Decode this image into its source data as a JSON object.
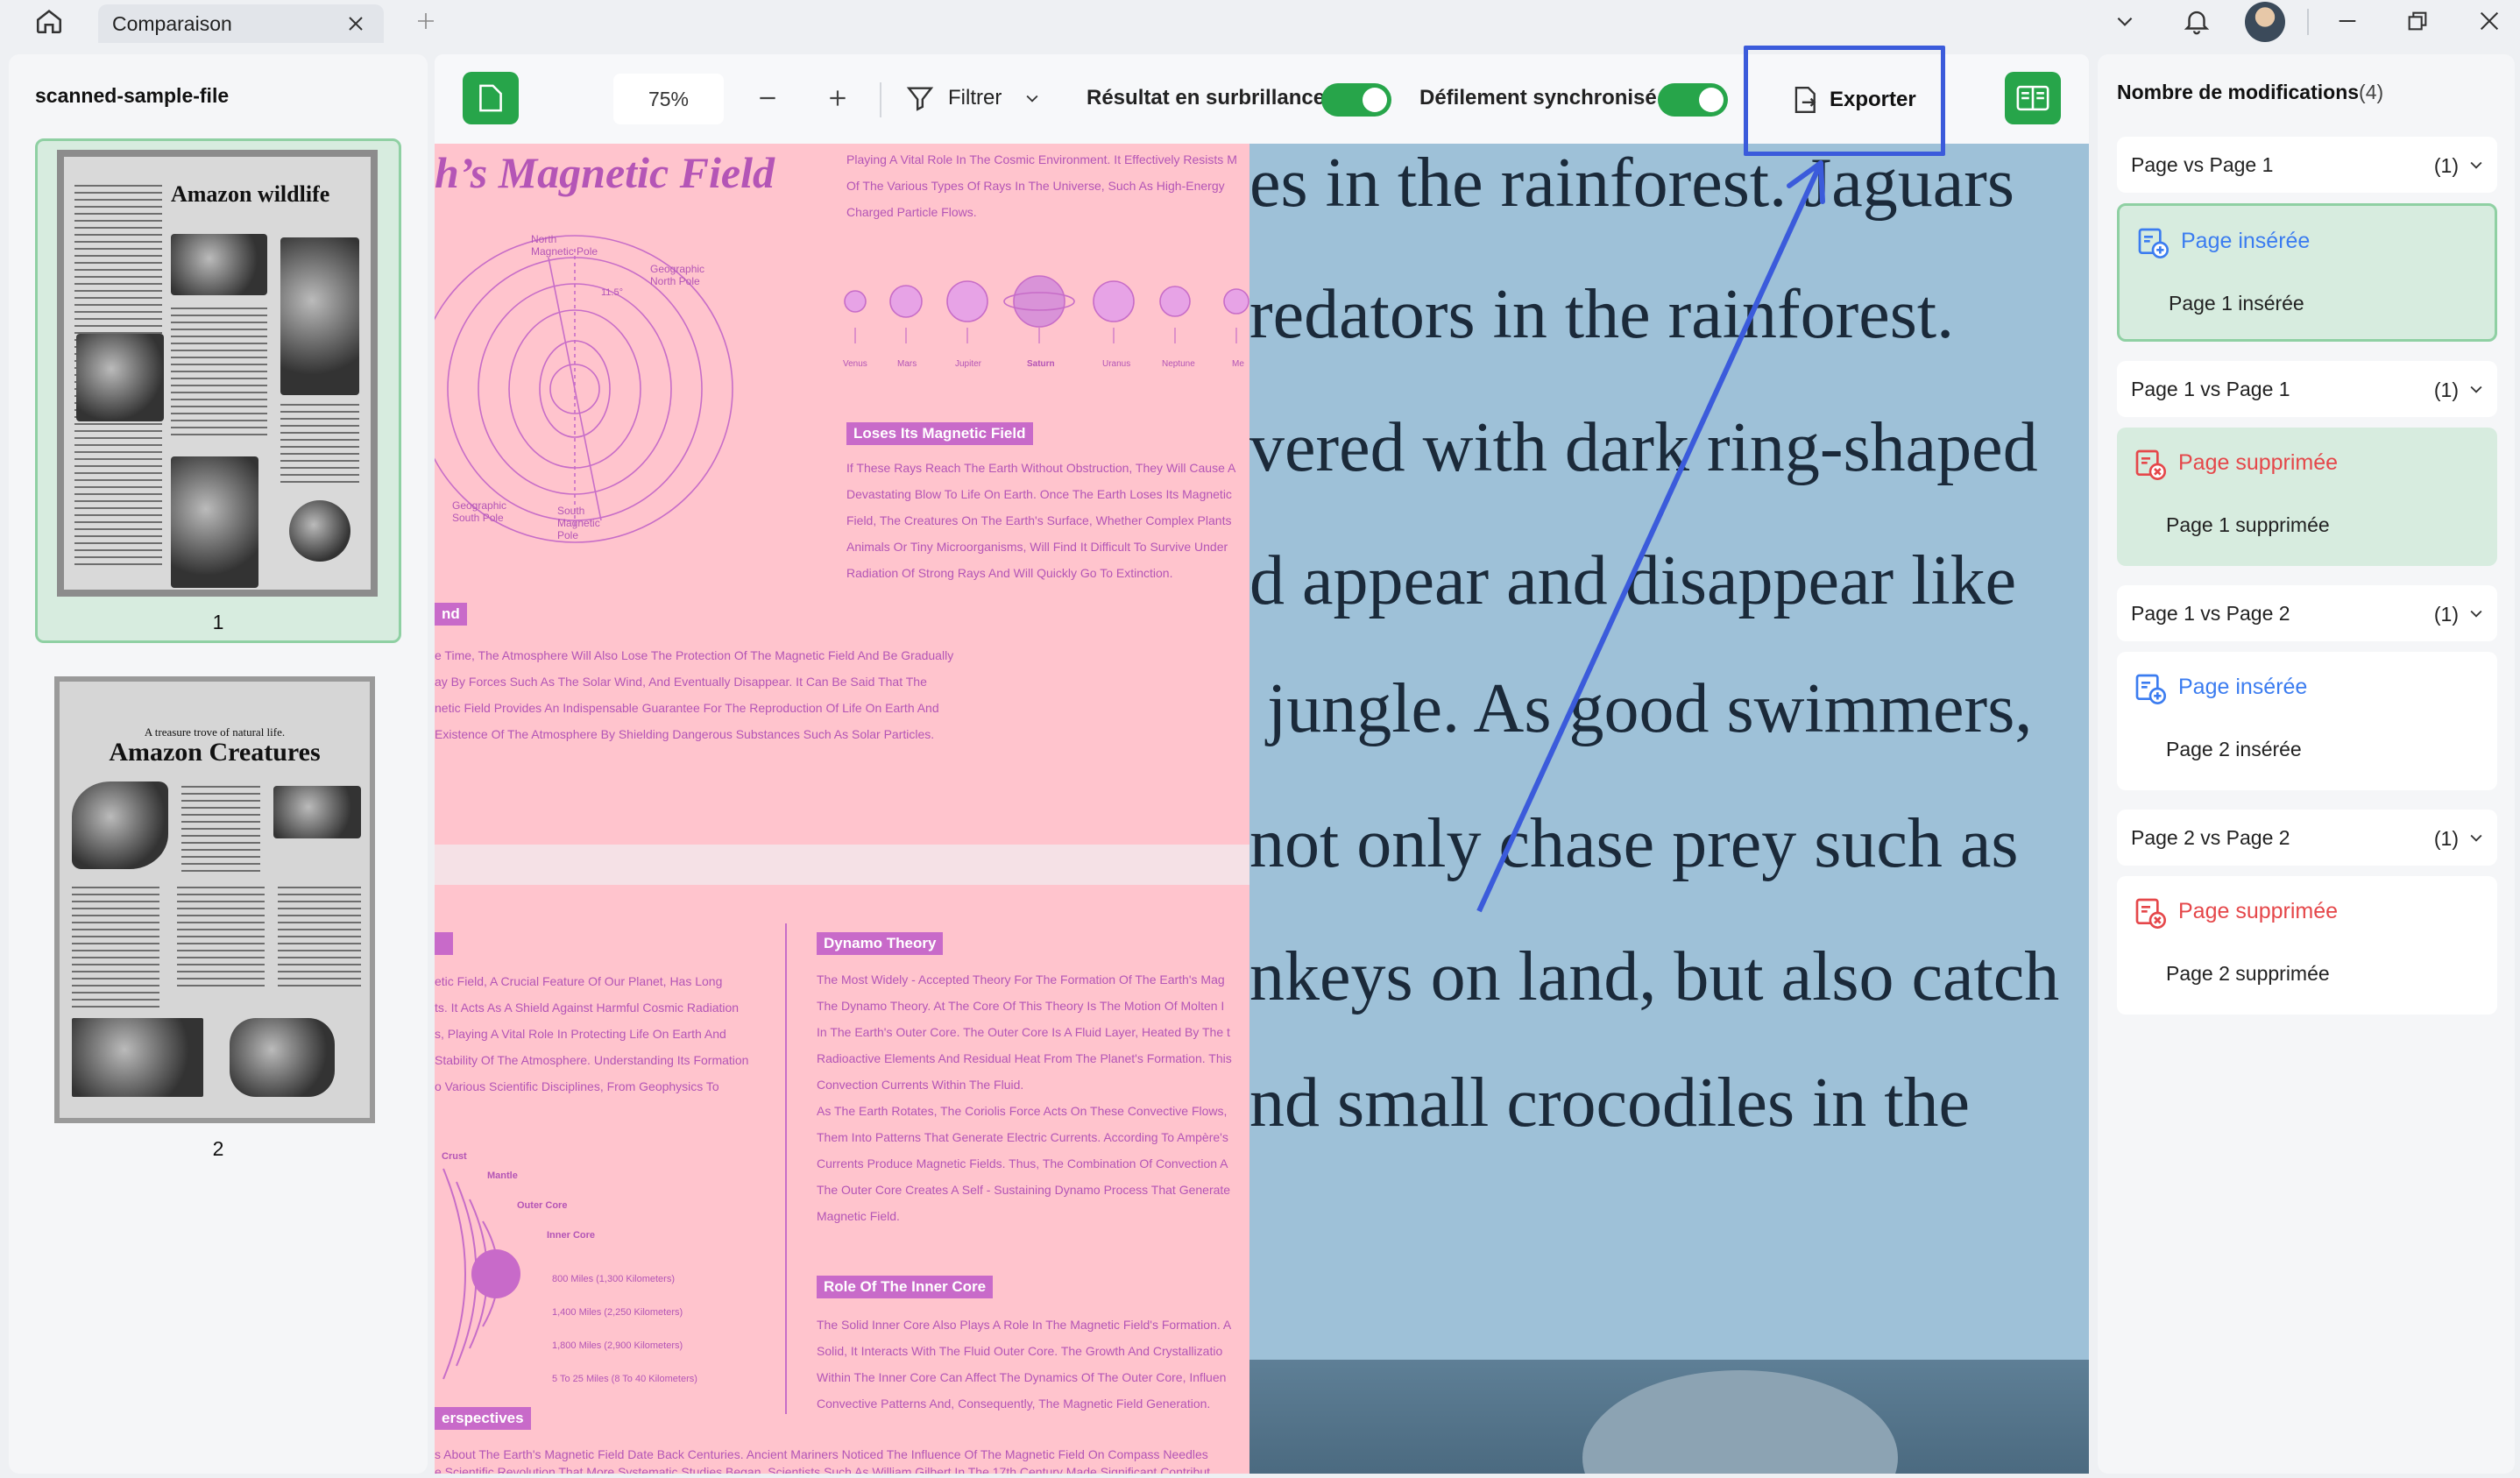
{
  "titlebar": {
    "tab_label": "Comparaison"
  },
  "left_panel": {
    "file_name": "scanned-sample-file",
    "thumbnails": [
      {
        "number": "1",
        "heading": "Amazon wildlife"
      },
      {
        "number": "2",
        "kicker": "A treasure trove of natural life.",
        "heading": "Amazon Creatures"
      }
    ]
  },
  "toolbar": {
    "zoom": "75%",
    "filter_label": "Filtrer",
    "highlight_label": "Résultat en surbrillance",
    "highlight_on": true,
    "sync_scroll_label": "Défilement synchronisé",
    "sync_scroll_on": true,
    "export_label": "Exporter"
  },
  "doc_left": {
    "title": "h’s Magnetic Field",
    "intro_lines": [
      "Playing A Vital Role In The Cosmic Environment. It Effectively Resists M",
      "Of The Various Types Of Rays In The Universe, Such As High-Energy",
      "Charged Particle Flows."
    ],
    "diagram_labels": {
      "north_pole": "North\nMagnetic Pole",
      "geo_north": "Geographic\nNorth Pole",
      "geo_south": "Geographic\nSouth Pole",
      "south_pole": "South\nMagnetic\nPole",
      "angle": "11.5°"
    },
    "planets": [
      "Venus",
      "Mars",
      "Jupiter",
      "Saturn",
      "Uranus",
      "Neptune",
      "Me"
    ],
    "loses_tag": "Loses Its Magnetic Field",
    "loses_lines": [
      "If These Rays Reach The Earth Without Obstruction, They Will Cause A",
      "Devastating Blow To Life On Earth. Once The Earth Loses Its Magnetic",
      "Field, The Creatures On The Earth's Surface, Whether Complex Plants",
      "Animals Or Tiny Microorganisms, Will Find It Difficult To Survive Under",
      "Radiation Of Strong Rays And Will Quickly Go To Extinction."
    ],
    "nd_tag": "nd",
    "lower_lines": [
      "e Time, The Atmosphere Will Also Lose The Protection Of The Magnetic Field And Be Gradually",
      "ay By Forces Such As The Solar Wind, And Eventually Disappear. It Can Be Said That The",
      "netic Field Provides An Indispensable Guarantee For The Reproduction Of Life On Earth And",
      "Existence Of The Atmosphere By Shielding Dangerous Substances Such As Solar Particles."
    ],
    "p2_left_lines": [
      "etic Field, A Crucial Feature Of Our Planet, Has Long",
      "ts. It Acts As A Shield Against Harmful Cosmic Radiation",
      "s, Playing A Vital Role In Protecting Life On Earth And",
      "Stability Of The Atmosphere. Understanding Its Formation",
      "o Various Scientific Disciplines, From Geophysics To"
    ],
    "dynamo_tag": "Dynamo Theory",
    "dynamo_lines": [
      "The Most Widely - Accepted Theory For The Formation Of The Earth's Mag",
      "The Dynamo Theory. At The Core Of This Theory Is The Motion Of Molten I",
      "In The Earth's Outer Core. The Outer Core Is A Fluid Layer, Heated By The t",
      "Radioactive Elements And Residual Heat From The Planet's Formation. This",
      "Convection Currents Within The Fluid.",
      "As The Earth Rotates, The Coriolis Force Acts On These Convective Flows,",
      "Them Into Patterns That Generate Electric Currents. According To Ampère's",
      "Currents Produce Magnetic Fields. Thus, The Combination Of Convection A",
      "The Outer Core Creates A Self - Sustaining Dynamo Process That Generate",
      "Magnetic Field."
    ],
    "core_labels": [
      "Crust",
      "Mantle",
      "Outer Core",
      "Inner Core"
    ],
    "core_distances": [
      "800 Miles (1,300 Kilometers)",
      "1,400 Miles (2,250 Kilometers)",
      "1,800 Miles (2,900 Kilometers)",
      "5 To 25 Miles (8 To 40 Kilometers)"
    ],
    "inner_tag": "Role Of The Inner Core",
    "inner_lines": [
      "The Solid Inner Core Also Plays A Role In The Magnetic Field's Formation. A",
      "Solid, It Interacts With The Fluid Outer Core. The Growth And Crystallizatio",
      "Within The Inner Core Can Affect The Dynamics Of The Outer Core, Influen",
      "Convective Patterns And, Consequently, The Magnetic Field Generation."
    ],
    "persp_tag": "erspectives",
    "bottom_lines": [
      "s About The Earth's Magnetic Field Date Back Centuries. Ancient Mariners Noticed The Influence Of The Magnetic Field On Compass Needles",
      "e Scientific Revolution That More Systematic Studies Began. Scientists Such As William Gilbert In The 17th Century Made Significant Contribut"
    ]
  },
  "doc_right": {
    "lines": [
      "es in the rainforest. Jaguars",
      "redators in the rainforest.",
      "vered with dark ring-shaped",
      "d appear and disappear like",
      " jungle. As good swimmers,",
      "not only chase prey such as",
      "nkeys on land, but also catch",
      "nd small crocodiles in the"
    ]
  },
  "right_panel": {
    "title_prefix": "Nombre de modifications",
    "title_count": "(4)",
    "groups": [
      {
        "header": "Page  vs Page 1",
        "count": "(1)",
        "kind": "ins",
        "label": "Page insérée",
        "sub": "Page 1 insérée",
        "active": true
      },
      {
        "header": "Page 1 vs Page 1",
        "count": "(1)",
        "kind": "del",
        "label": "Page supprimée",
        "sub": "Page 1 supprimée",
        "active": true
      },
      {
        "header": "Page 1 vs Page 2",
        "count": "(1)",
        "kind": "ins",
        "label": "Page insérée",
        "sub": "Page 2 insérée",
        "active": false
      },
      {
        "header": "Page 2 vs Page 2",
        "count": "(1)",
        "kind": "del",
        "label": "Page supprimée",
        "sub": "Page 2 supprimée",
        "active": false
      }
    ]
  },
  "colors": {
    "accent_green": "#27a54a",
    "insert_blue": "#3b7cf0",
    "delete_red": "#e5474a",
    "annotation_blue": "#3b5bdb",
    "left_doc_bg": "#ffc4cd",
    "right_doc_bg": "#9ec1d8"
  }
}
